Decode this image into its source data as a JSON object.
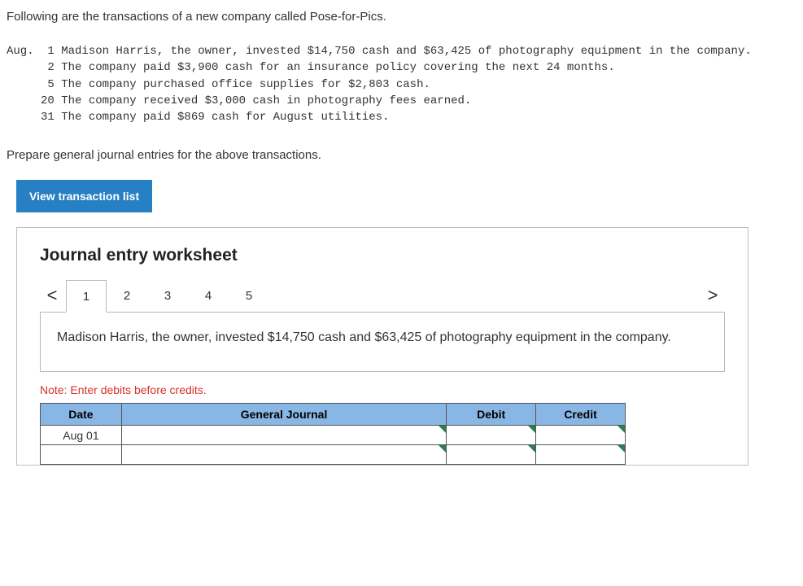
{
  "intro": "Following are the transactions of a new company called Pose-for-Pics.",
  "trans_prefix": "Aug.",
  "transactions": [
    {
      "day": "1",
      "text": "Madison Harris, the owner, invested $14,750 cash and $63,425 of photography equipment in the company."
    },
    {
      "day": "2",
      "text": "The company paid $3,900 cash for an insurance policy covering the next 24 months."
    },
    {
      "day": "5",
      "text": "The company purchased office supplies for $2,803 cash."
    },
    {
      "day": "20",
      "text": "The company received $3,000 cash in photography fees earned."
    },
    {
      "day": "31",
      "text": "The company paid $869 cash for August utilities."
    }
  ],
  "prepare": "Prepare general journal entries for the above transactions.",
  "view_btn": "View transaction list",
  "ws_title": "Journal entry worksheet",
  "nav_prev": "<",
  "nav_next": ">",
  "tabs": [
    "1",
    "2",
    "3",
    "4",
    "5"
  ],
  "active_tab_index": 0,
  "entry_desc": "Madison Harris, the owner, invested $14,750 cash and $63,425 of photography equipment in the company.",
  "note": "Note: Enter debits before credits.",
  "headers": {
    "date": "Date",
    "gj": "General Journal",
    "debit": "Debit",
    "credit": "Credit"
  },
  "rows": [
    {
      "date": "Aug 01",
      "gj": "",
      "debit": "",
      "credit": ""
    },
    {
      "date": "",
      "gj": "",
      "debit": "",
      "credit": ""
    }
  ]
}
